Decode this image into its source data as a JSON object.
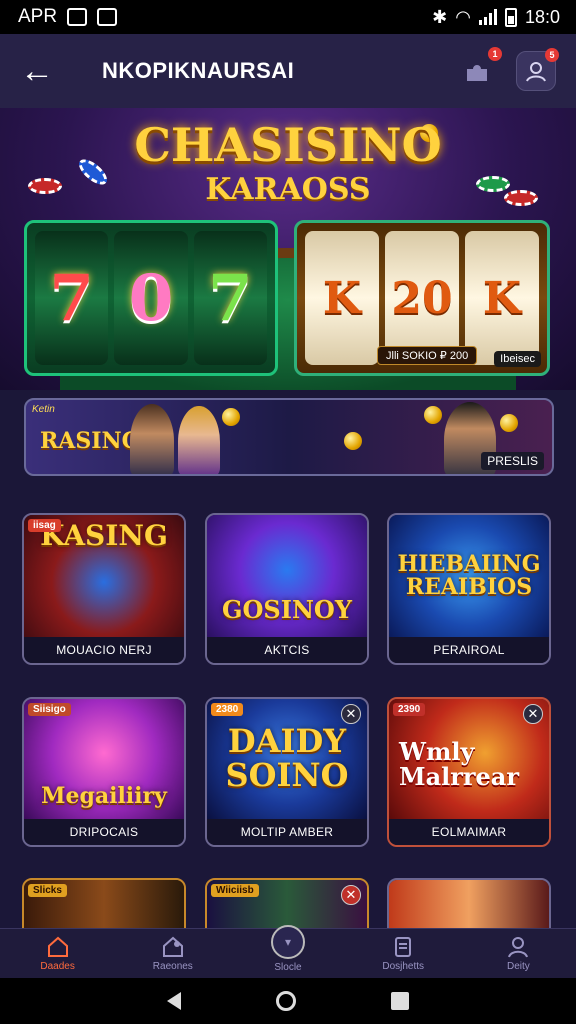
{
  "status_bar": {
    "carrier": "APR",
    "time": "18:0"
  },
  "header": {
    "title": "NKOPIKNAURSAI",
    "notification_badge": "1",
    "profile_badge": "5"
  },
  "hero": {
    "logo_line1": "CHASISINO",
    "logo_line2": "KARAOSS",
    "left_reels": [
      "7",
      "0",
      "7"
    ],
    "right_reels": [
      "K",
      "20",
      "K"
    ],
    "reel_caption": "Jlli SOKIO   ₽  200",
    "reel_tag": "Ibeisec"
  },
  "promo": {
    "corner": "Ketin",
    "left_title": "RASING",
    "right_label": "PRESLIS"
  },
  "games": [
    {
      "title": "KASING",
      "label": "MOUACIO NERJ",
      "tag": "iisag"
    },
    {
      "title": "GOSINOY",
      "label": "AKTCIS"
    },
    {
      "title": "HIEBAIING REAIBIOS",
      "label": "PERAIROAL"
    },
    {
      "title": "Megailiiry",
      "label": "DRIPOCAIS",
      "tag": "Siisigo"
    },
    {
      "title": "DAIDY SOINO",
      "label": "MOLTIP AMBER",
      "tag": "2380"
    },
    {
      "title": "Wmly Malrrear",
      "label": "EOLMAIMAR",
      "tag": "2390"
    },
    {
      "title": "",
      "label": "",
      "tag": "Slicks"
    },
    {
      "title": "",
      "label": "",
      "tag": "Wiiciisb"
    },
    {
      "title": "",
      "label": ""
    }
  ],
  "bottom_nav": [
    {
      "label": "Daades",
      "icon": "home-icon"
    },
    {
      "label": "Raeones",
      "icon": "house-plus-icon"
    },
    {
      "label": "Slocle",
      "icon": "play-circle-icon"
    },
    {
      "label": "Dosjhetts",
      "icon": "document-icon"
    },
    {
      "label": "Deity",
      "icon": "user-icon"
    }
  ],
  "colors": {
    "accent": "#ff6b3d",
    "background": "#1b1738",
    "header": "#272247",
    "gold": "#ffd23e"
  }
}
